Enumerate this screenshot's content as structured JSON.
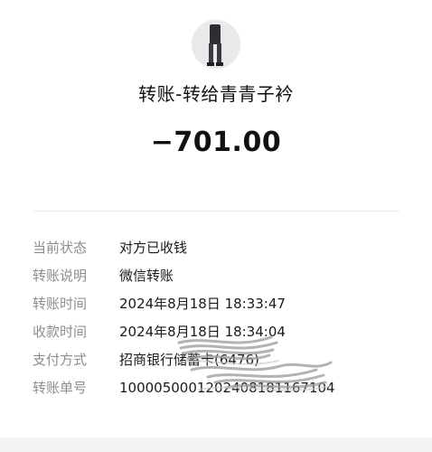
{
  "header": {
    "title": "转账-转给青青子衿",
    "amount": "−701.00"
  },
  "details": [
    {
      "label": "当前状态",
      "value": "对方已收钱"
    },
    {
      "label": "转账说明",
      "value": "微信转账"
    },
    {
      "label": "转账时间",
      "value": "2024年8月18日 18:33:47"
    },
    {
      "label": "收款时间",
      "value": "2024年8月18日 18:34:04"
    },
    {
      "label": "支付方式",
      "value": "招商银行储蓄卡(6476)"
    },
    {
      "label": "转账单号",
      "value": "1000050001202408181167104"
    }
  ]
}
